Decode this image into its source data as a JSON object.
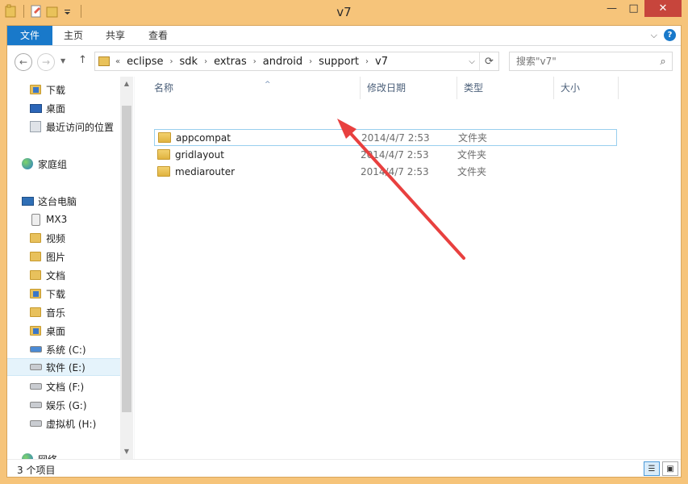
{
  "window": {
    "title": "v7",
    "controls": {
      "minimize": "—",
      "maximize": "□",
      "close": "✕"
    }
  },
  "ribbon": {
    "tabs": [
      "文件",
      "主页",
      "共享",
      "查看"
    ],
    "collapse_icon": "chevron-down-icon",
    "help": "?"
  },
  "address": {
    "overflow": "«",
    "crumbs": [
      "eclipse",
      "sdk",
      "extras",
      "android",
      "support",
      "v7"
    ],
    "refresh": "⟳"
  },
  "search": {
    "placeholder": "搜索\"v7\""
  },
  "nav": {
    "favorites": [
      "下载",
      "桌面",
      "最近访问的位置"
    ],
    "homegroup": "家庭组",
    "thispc": "这台电脑",
    "pc_items": [
      "MX3",
      "视频",
      "图片",
      "文档",
      "下载",
      "音乐",
      "桌面",
      "系统 (C:)",
      "软件 (E:)",
      "文档 (F:)",
      "娱乐 (G:)",
      "虚拟机 (H:)"
    ],
    "network": "网络",
    "selected": "软件 (E:)"
  },
  "columns": {
    "name": "名称",
    "date": "修改日期",
    "type": "类型",
    "size": "大小"
  },
  "files": [
    {
      "name": "appcompat",
      "date": "2014/4/7 2:53",
      "type": "文件夹"
    },
    {
      "name": "gridlayout",
      "date": "2014/4/7 2:53",
      "type": "文件夹"
    },
    {
      "name": "mediarouter",
      "date": "2014/4/7 2:53",
      "type": "文件夹"
    }
  ],
  "status": {
    "count": "3 个项目"
  },
  "annotation": {
    "color": "#e8403f"
  }
}
